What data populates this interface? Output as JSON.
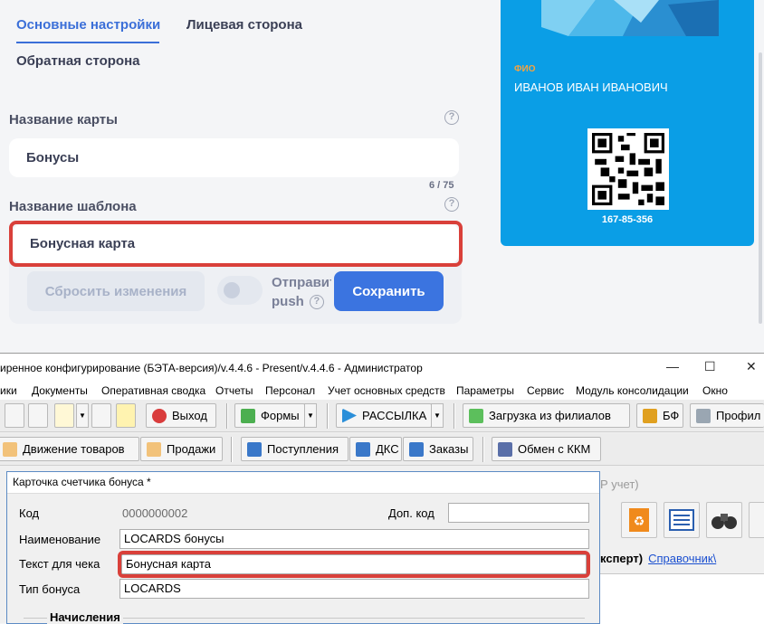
{
  "web": {
    "tabs": [
      "Основные настройки",
      "Лицевая сторона",
      "Обратная сторона"
    ],
    "card_name_label": "Название карты",
    "card_name_value": "Бонусы",
    "card_name_counter": "6 / 75",
    "template_label": "Название шаблона",
    "template_value": "Бонусная карта",
    "help_glyph": "?",
    "reset_label": "Сбросить изменения",
    "push_label_line1": "Отправить",
    "push_label_line2": "push",
    "save_label": "Сохранить",
    "card": {
      "fio_label": "ФИО",
      "fio_value": "ИВАНОВ ИВАН ИВАНОВИЧ",
      "number": "167-85-356"
    },
    "colors": {
      "accent": "#3b74e0",
      "card_bg": "#0a9ee6",
      "highlight": "#d9403a"
    }
  },
  "app": {
    "window_title": "иренное конфигурирование (БЭТА-версия)/v.4.4.6 - Present/v.4.4.6 - Администратор",
    "window_controls": [
      "—",
      "☐",
      "✕"
    ],
    "menu": [
      "ики",
      "Документы",
      "Оперативная сводка",
      "Отчеты",
      "Персонал",
      "Учет основных средств",
      "Параметры",
      "Сервис",
      "Модуль консолидации",
      "Окно"
    ],
    "toolbar1": {
      "exit": "Выход",
      "forms": "Формы",
      "mailing": "РАССЫЛКА",
      "load_branches": "Загрузка из филиалов",
      "bf": "БФ",
      "profile": "Профил"
    },
    "toolbar2": {
      "movement": "Движение товаров",
      "sales": "Продажи",
      "receipts": "Поступления",
      "dks": "ДКС",
      "orders": "Заказы",
      "kkm": "Обмен с ККМ"
    },
    "background": {
      "tab_fragment": "Р учет)",
      "bold_fragment": "ксперт)",
      "link": "Справочник\\"
    },
    "dialog": {
      "title": "Карточка счетчика бонуса *",
      "code_label": "Код",
      "code_value": "0000000002",
      "extra_code_label": "Доп. код",
      "extra_code_value": "",
      "name_label": "Наименование",
      "name_value": "LOCARDS бонусы",
      "receipt_label": "Текст для чека",
      "receipt_value": "Бонусная карта",
      "type_label": "Тип бонуса",
      "type_value": "LOCARDS",
      "section": "Начисления"
    }
  }
}
